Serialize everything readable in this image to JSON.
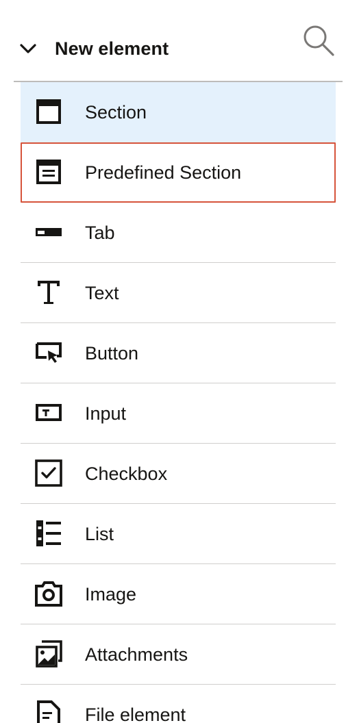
{
  "header": {
    "title": "New element",
    "collapse_icon": "chevron-down-icon",
    "search_icon": "search-icon"
  },
  "colors": {
    "selected_bg": "#e4f1fc",
    "focus_outline": "#d6533a",
    "divider": "#cfcecc",
    "text": "#161513"
  },
  "items": [
    {
      "label": "Section",
      "icon": "section-icon",
      "state": "selected"
    },
    {
      "label": "Predefined Section",
      "icon": "predefined-section-icon",
      "state": "focused"
    },
    {
      "label": "Tab",
      "icon": "tab-icon"
    },
    {
      "label": "Text",
      "icon": "text-icon"
    },
    {
      "label": "Button",
      "icon": "button-icon"
    },
    {
      "label": "Input",
      "icon": "input-icon"
    },
    {
      "label": "Checkbox",
      "icon": "checkbox-icon"
    },
    {
      "label": "List",
      "icon": "list-icon"
    },
    {
      "label": "Image",
      "icon": "image-icon"
    },
    {
      "label": "Attachments",
      "icon": "attachments-icon"
    },
    {
      "label": "File element",
      "icon": "file-element-icon"
    }
  ]
}
